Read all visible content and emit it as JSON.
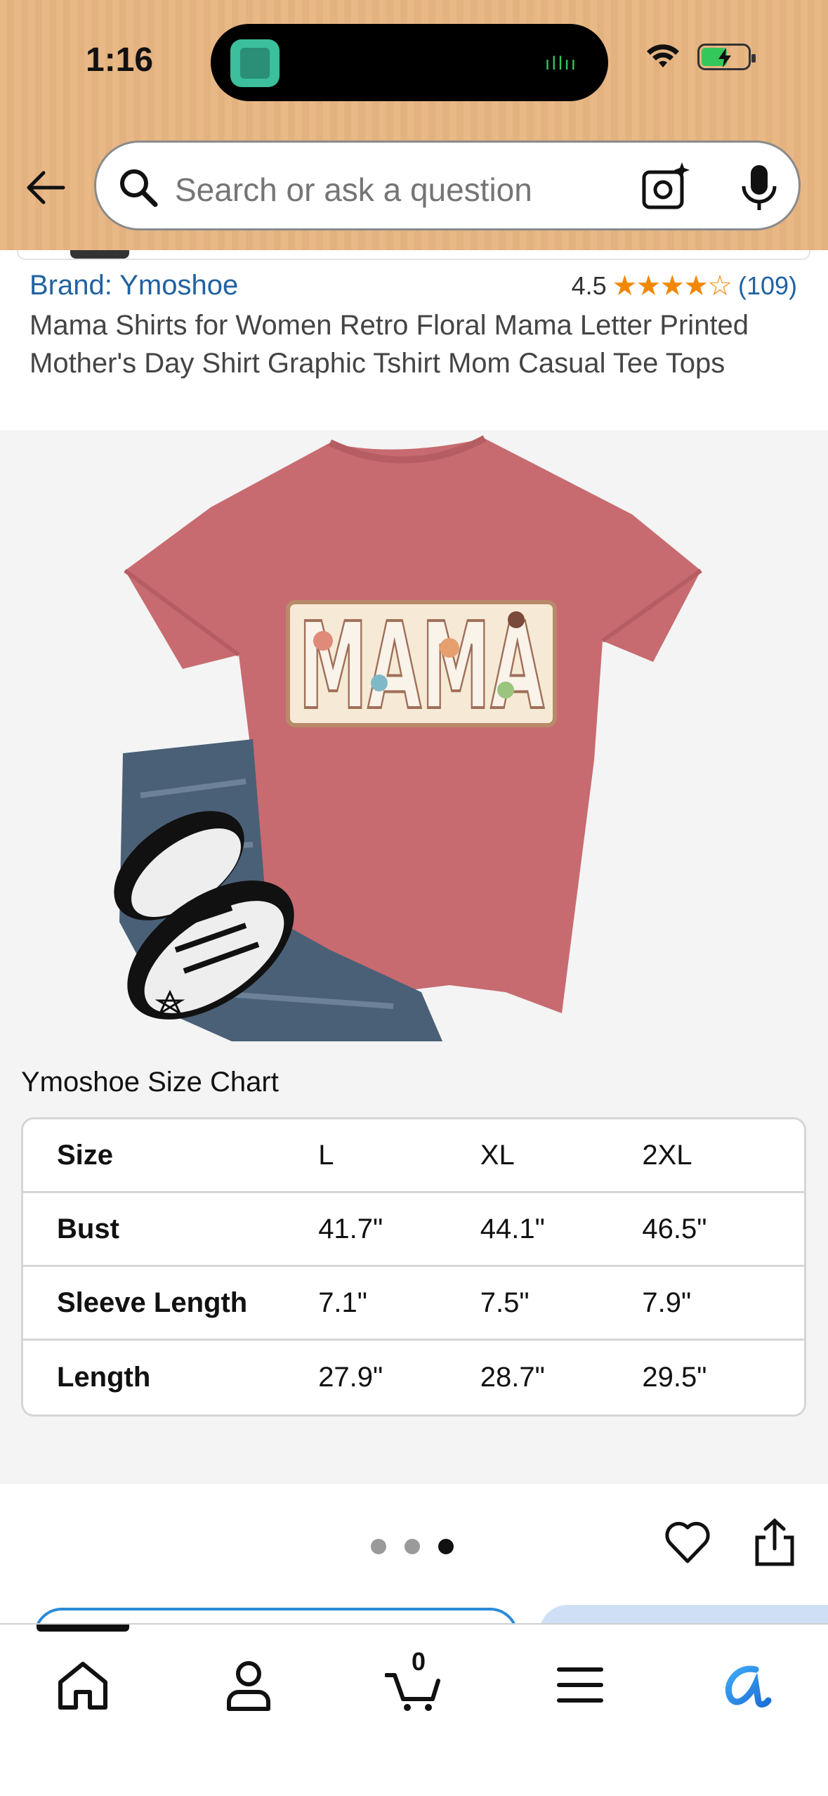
{
  "status_bar": {
    "time": "1:16"
  },
  "search": {
    "placeholder": "Search or ask a question"
  },
  "product": {
    "brand": "Brand: Ymoshoe",
    "rating": "4.5",
    "stars": "★★★★☆",
    "review_count": "(109)",
    "title": "Mama Shirts for Women Retro Floral Mama Letter Printed Mother's Day Shirt Graphic Tshirt Mom Casual Tee Tops",
    "shirt_text": "MAMA"
  },
  "size_chart": {
    "title": "Ymoshoe Size Chart",
    "header": [
      "Size",
      "L",
      "XL",
      "2XL"
    ],
    "rows": [
      [
        "Bust",
        "41.7\"",
        "44.1\"",
        "46.5\""
      ],
      [
        "Sleeve Length",
        "7.1\"",
        "7.5\"",
        "7.9\""
      ],
      [
        "Length",
        "27.9\"",
        "28.7\"",
        "29.5\""
      ]
    ]
  },
  "gallery": {
    "page_count": 3,
    "active_index": 2
  },
  "bottom_nav": {
    "cart_count": "0",
    "items": [
      "home-icon",
      "account-icon",
      "cart-icon",
      "menu-icon",
      "rufus-icon"
    ]
  },
  "colors": {
    "header_bg": "#e8b887",
    "link_blue": "#2162a1",
    "star_orange": "#f08804",
    "shirt_pink": "#c76b70",
    "accent_blue": "#2a8bd8"
  }
}
